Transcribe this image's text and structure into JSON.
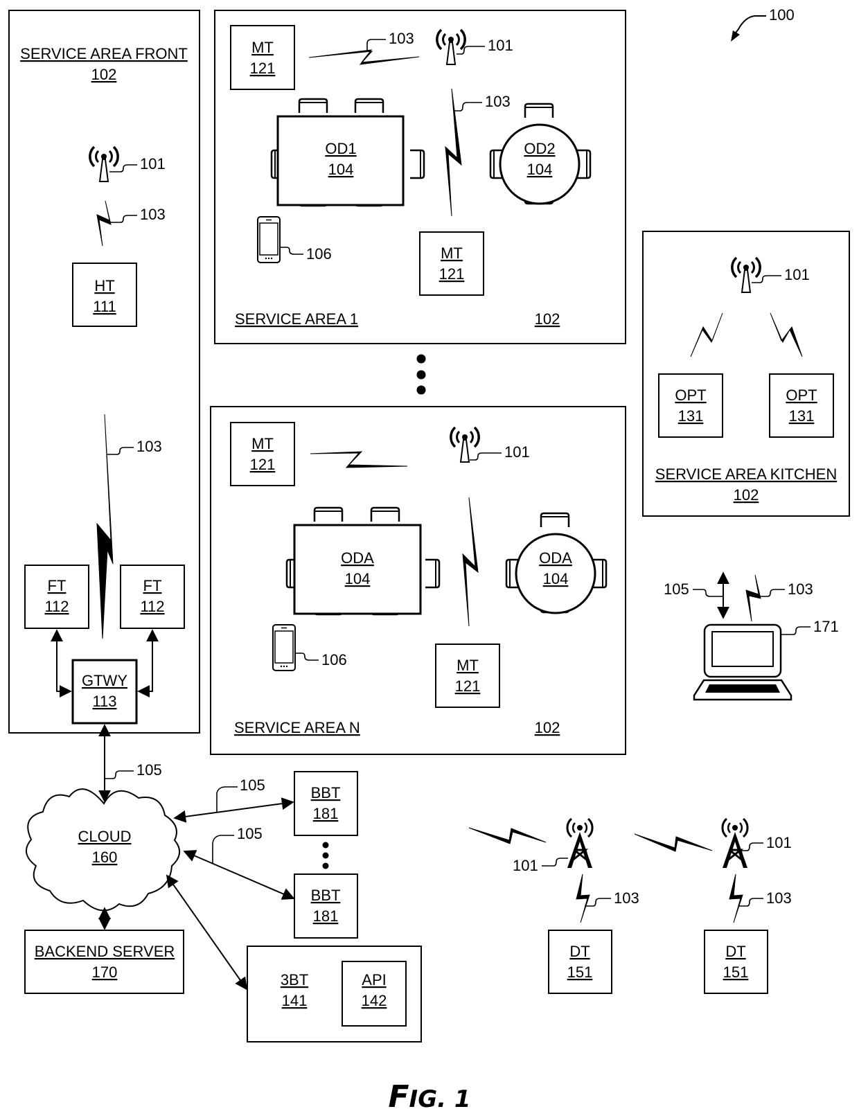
{
  "figure": {
    "ref_main": "100",
    "caption_f": "F",
    "caption_rest": "IG. 1"
  },
  "areas": {
    "front": {
      "title": "SERVICE AREA FRONT",
      "ref": "102"
    },
    "area1": {
      "title": "SERVICE AREA 1",
      "ref": "102"
    },
    "areaN": {
      "title": "SERVICE AREA N",
      "ref": "102"
    },
    "kitchen": {
      "title": "SERVICE AREA KITCHEN",
      "ref": "102"
    }
  },
  "nodes": {
    "ht": {
      "name": "HT",
      "ref": "111"
    },
    "ft": {
      "name": "FT",
      "ref": "112"
    },
    "gtwy": {
      "name": "GTWY",
      "ref": "113"
    },
    "mt": {
      "name": "MT",
      "ref": "121"
    },
    "od1": {
      "name": "OD1",
      "ref": "104"
    },
    "od2": {
      "name": "OD2",
      "ref": "104"
    },
    "oda": {
      "name": "ODA",
      "ref": "104"
    },
    "opt": {
      "name": "OPT",
      "ref": "131"
    },
    "cloud": {
      "name": "CLOUD",
      "ref": "160"
    },
    "backend": {
      "name": "BACKEND SERVER",
      "ref": "170"
    },
    "bbt": {
      "name": "BBT",
      "ref": "181"
    },
    "tbt": {
      "name": "3BT",
      "ref": "141"
    },
    "api": {
      "name": "API",
      "ref": "142"
    },
    "dt": {
      "name": "DT",
      "ref": "151"
    }
  },
  "refs": {
    "access_point": "101",
    "wireless_link": "103",
    "wired_link": "105",
    "mobile_device": "106",
    "laptop": "171"
  }
}
